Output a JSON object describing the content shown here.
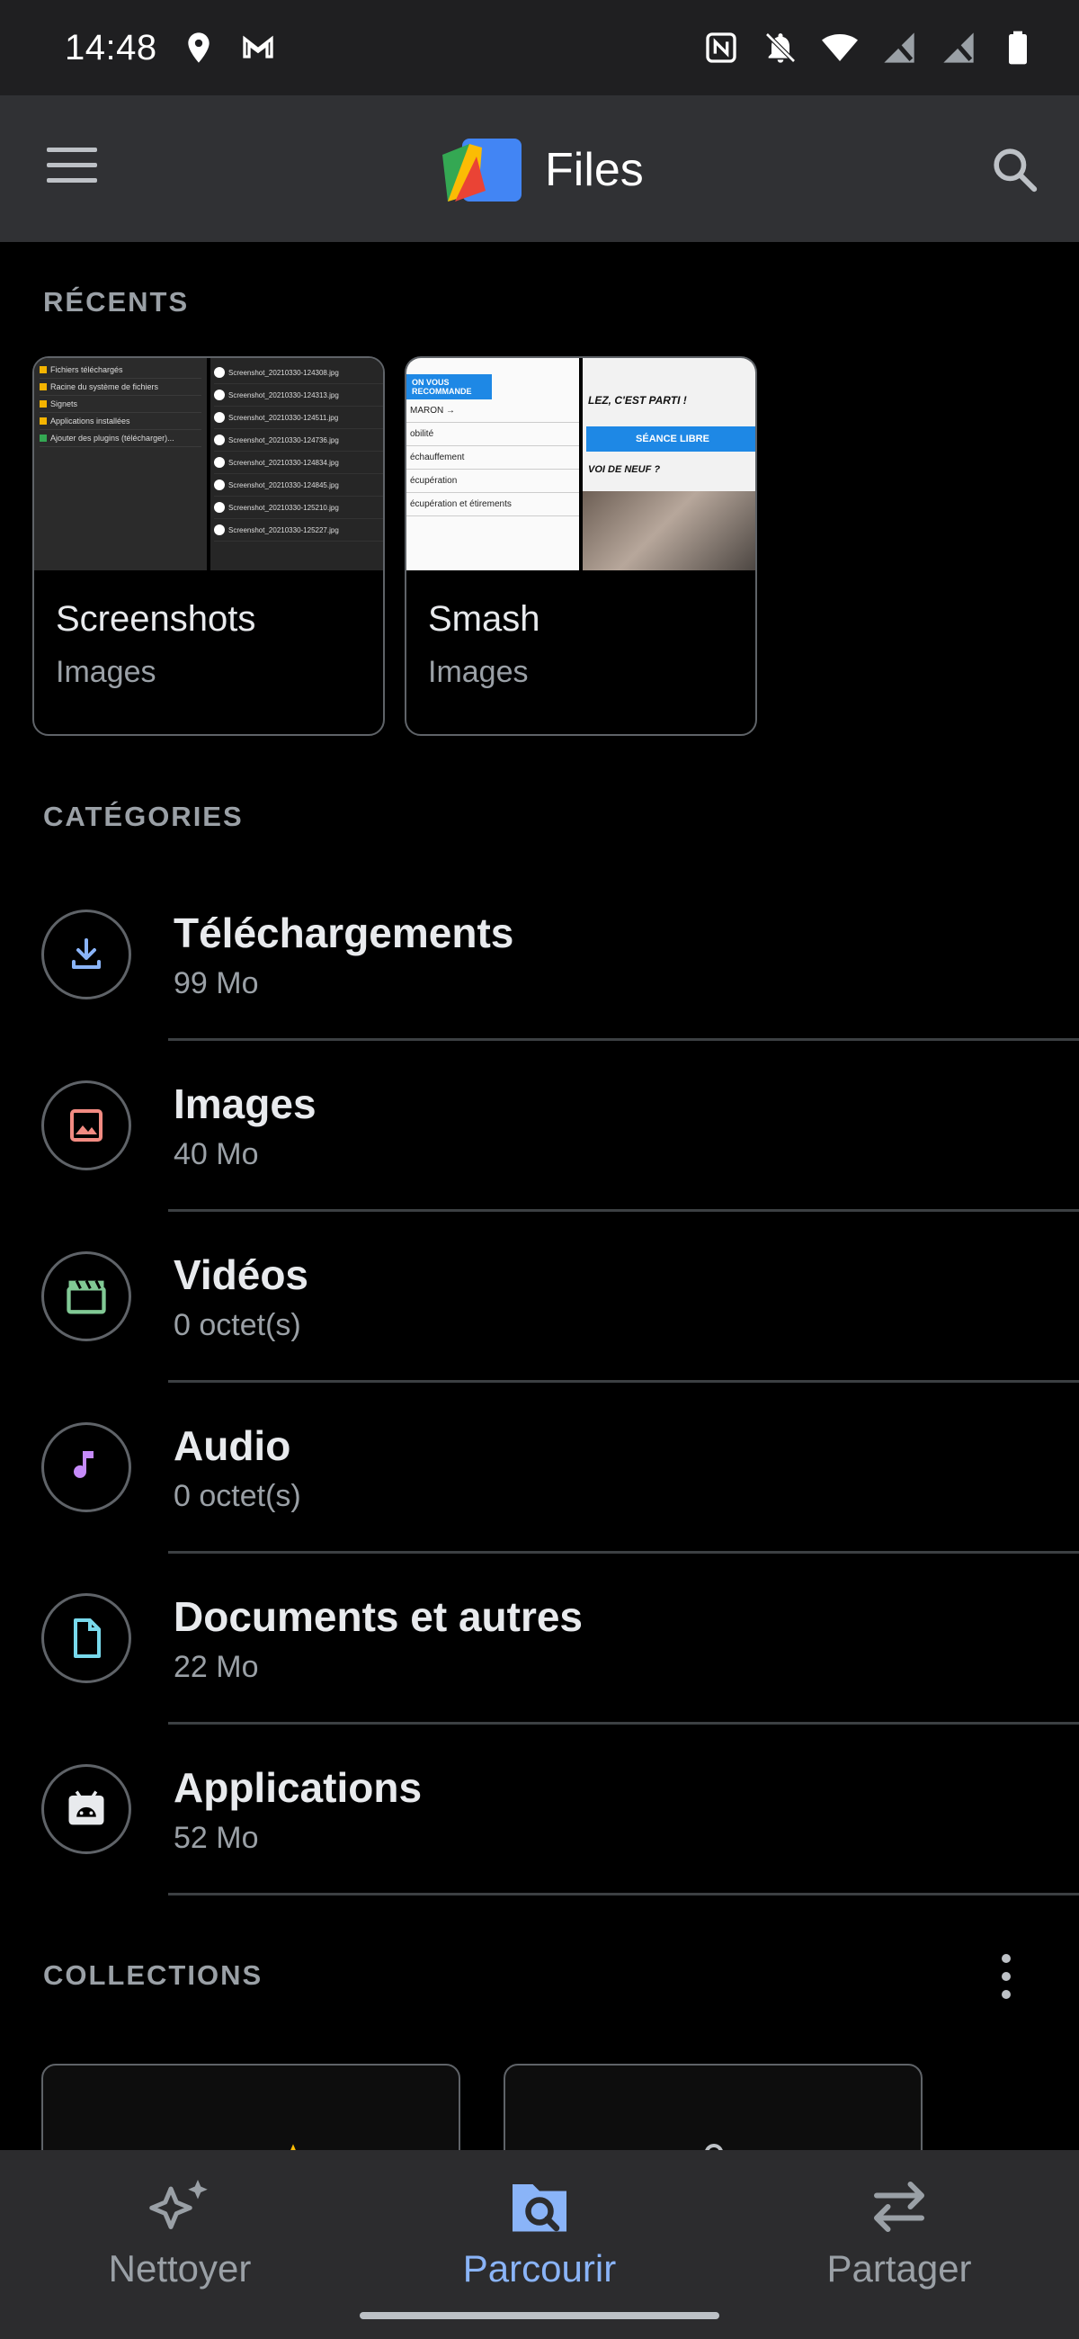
{
  "status_bar": {
    "time": "14:48",
    "left_icons": [
      "location-icon",
      "gmail-icon"
    ],
    "right_icons": [
      "nfc-icon",
      "bell-off-icon",
      "wifi-icon",
      "no-signal-icon",
      "no-signal-icon",
      "battery-icon"
    ]
  },
  "app_bar": {
    "title": "Files",
    "menu_icon": "menu-icon",
    "search_icon": "search-icon"
  },
  "recents": {
    "label": "RÉCENTS",
    "items": [
      {
        "name": "Screenshots",
        "kind": "Images",
        "thumb_left_lines": [
          "Fichiers téléchargés",
          "Racine du système de fichiers",
          "Signets",
          "Applications installées",
          "Ajouter des plugins (télécharger)..."
        ],
        "thumb_right_files": [
          "Screenshot_20210330-124308.jpg",
          "Screenshot_20210330-124313.jpg",
          "Screenshot_20210330-124511.jpg",
          "Screenshot_20210330-124736.jpg",
          "Screenshot_20210330-124834.jpg",
          "Screenshot_20210330-124845.jpg",
          "Screenshot_20210330-125210.jpg",
          "Screenshot_20210330-125227.jpg"
        ]
      },
      {
        "name": "Smash",
        "kind": "Images",
        "thumb_left_banner": "ON VOUS RECOMMANDE",
        "thumb_left_rows": [
          "MARON →",
          "obilité",
          "échauffement",
          "écupération",
          "écupération et étirements"
        ],
        "thumb_right_heading": "LEZ, C'EST PARTI !",
        "thumb_right_button": "SÉANCE LIBRE",
        "thumb_right_sub": "VOI DE NEUF ?"
      }
    ]
  },
  "categories": {
    "label": "CATÉGORIES",
    "items": [
      {
        "name": "Téléchargements",
        "size": "99 Mo",
        "icon": "download-icon",
        "color": "#8ab4f8"
      },
      {
        "name": "Images",
        "size": "40 Mo",
        "icon": "image-icon",
        "color": "#f28b82"
      },
      {
        "name": "Vidéos",
        "size": "0 octet(s)",
        "icon": "video-icon",
        "color": "#81c995"
      },
      {
        "name": "Audio",
        "size": "0 octet(s)",
        "icon": "music-note-icon",
        "color": "#c58af9"
      },
      {
        "name": "Documents et autres",
        "size": "22 Mo",
        "icon": "document-icon",
        "color": "#78d9ec"
      },
      {
        "name": "Applications",
        "size": "52 Mo",
        "icon": "android-icon",
        "color": "#e8eaed"
      }
    ]
  },
  "collections": {
    "label": "COLLECTIONS",
    "more_icon": "more-vert-icon"
  },
  "bottom_nav": {
    "items": [
      {
        "label": "Nettoyer",
        "icon": "sparkle-icon",
        "active": false
      },
      {
        "label": "Parcourir",
        "icon": "browse-icon",
        "active": true
      },
      {
        "label": "Partager",
        "icon": "swap-icon",
        "active": false
      }
    ]
  },
  "colors": {
    "accent": "#8ab4f8",
    "background": "#000000",
    "app_bar": "#303134",
    "bottom_nav": "#2c2c2e"
  }
}
